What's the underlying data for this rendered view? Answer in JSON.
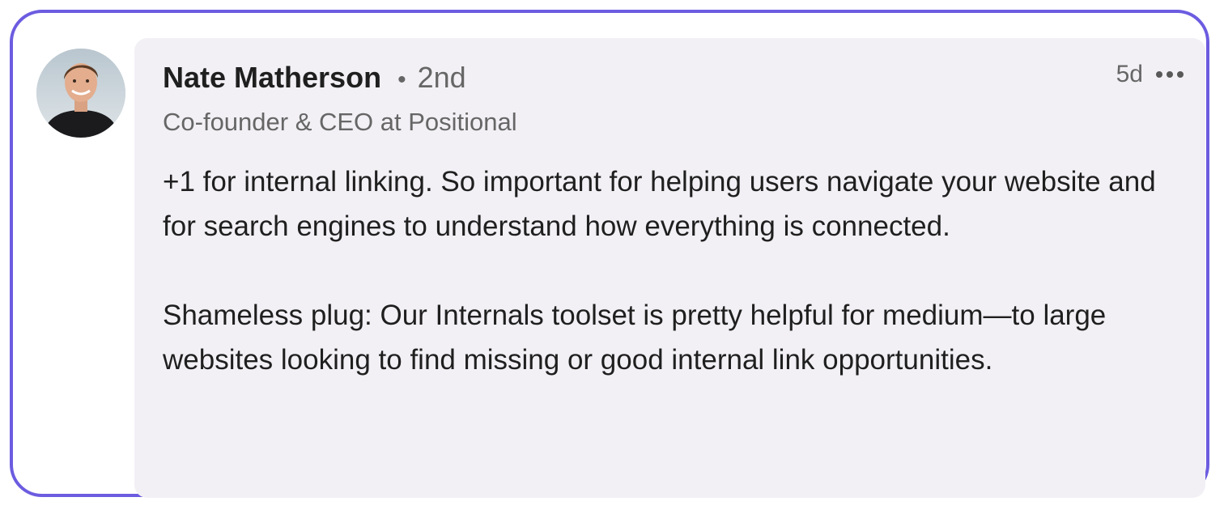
{
  "comment": {
    "author": {
      "name": "Nate Matherson",
      "degree_separator": "•",
      "degree": "2nd",
      "headline": "Co-founder & CEO at Positional"
    },
    "timestamp": "5d",
    "more_icon": "more-horizontal-icon",
    "paragraphs": [
      "+1 for internal linking. So important for helping users navigate your website and for search engines to understand how everything is connected.",
      "Shameless plug: Our Internals toolset is pretty helpful for medium—to large websites looking to find missing or good internal link opportunities."
    ]
  },
  "colors": {
    "frame_border": "#6c5ce0",
    "bubble_background": "#f2f0f5",
    "primary_text": "#1f1f1f",
    "secondary_text": "#666666"
  }
}
